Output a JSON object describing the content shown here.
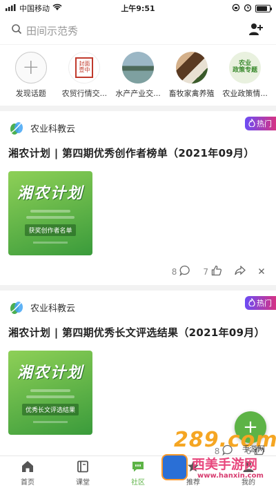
{
  "status_bar": {
    "carrier": "中国移动",
    "time": "上午9:51",
    "battery_level": 0.85
  },
  "search": {
    "placeholder": "田间示范秀"
  },
  "topics": [
    {
      "label": "发现话题",
      "icon": "plus-icon"
    },
    {
      "label": "农贸行情交...",
      "icon_text": "封面\n壹中"
    },
    {
      "label": "水产产业交...",
      "icon": "aquaculture-image"
    },
    {
      "label": "畜牧家禽养殖",
      "icon": "livestock-image"
    },
    {
      "label": "农业政策情...",
      "icon_text": "农业\n政策专题"
    }
  ],
  "posts": [
    {
      "author": "农业科教云",
      "badge": "热门",
      "title": "湘农计划 | 第四期优秀创作者榜单（2021年09月）",
      "cover_main": "湘农计划",
      "cover_band": "获奖创作者名单",
      "comments": "8",
      "likes": "7"
    },
    {
      "author": "农业科教云",
      "badge": "热门",
      "title": "湘农计划 | 第四期优秀长文评选结果（2021年09月）",
      "cover_main": "湘农计划",
      "cover_band": "优秀长文评选结果",
      "comments": "8",
      "likes": "6"
    }
  ],
  "fab": {
    "label": "+"
  },
  "tabs": [
    {
      "label": "首页",
      "icon": "home-icon"
    },
    {
      "label": "课堂",
      "icon": "book-icon"
    },
    {
      "label": "社区",
      "icon": "chat-icon"
    },
    {
      "label": "推荐",
      "icon": "star-icon"
    },
    {
      "label": "我的",
      "icon": "user-icon"
    }
  ],
  "active_tab": "社区",
  "watermark": {
    "big": "289.com",
    "sub": "手游网",
    "name": "西美手游网",
    "url": "www.hanxin.com"
  }
}
